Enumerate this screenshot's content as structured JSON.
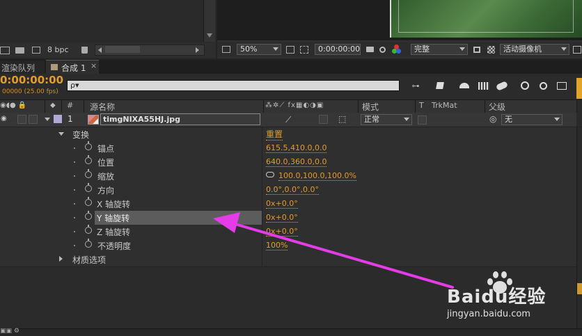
{
  "project_panel": {
    "bpc_label": "8 bpc"
  },
  "viewer": {
    "zoom": "50%",
    "timecode": "0:00:00:00",
    "resolution": "完整",
    "camera": "活动摄像机"
  },
  "tabs": [
    {
      "label": "渲染队列"
    },
    {
      "label": "合成 1"
    }
  ],
  "timeline": {
    "current_time": "0:00:00:00",
    "frame_info": "00000 (25.00 fps)",
    "search_placeholder": "",
    "search_glyph": "ρ▾",
    "columns": {
      "num": "#",
      "source_name": "源名称",
      "mode": "模式",
      "t": "T",
      "trkmat": "TrkMat",
      "parent": "父级"
    },
    "layer": {
      "index": "1",
      "name": "timgNIXA55HJ.jpg",
      "mode": "正常",
      "parent": "无"
    },
    "transform": {
      "label": "变换",
      "reset": "重置",
      "properties": [
        {
          "name": "锚点",
          "value": "615.5,410.0,0.0"
        },
        {
          "name": "位置",
          "value": "640.0,360.0,0.0"
        },
        {
          "name": "缩放",
          "value": "100.0,100.0,100.0%"
        },
        {
          "name": "方向",
          "value": "0.0°,0.0°,0.0°"
        },
        {
          "name": "X 轴旋转",
          "value": "0x+0.0°"
        },
        {
          "name": "Y 轴旋转",
          "value": "0x+0.0°"
        },
        {
          "name": "Z 轴旋转",
          "value": "0x+0.0°"
        },
        {
          "name": "不透明度",
          "value": "100%"
        }
      ]
    },
    "material_options": "材质选项"
  },
  "colors": {
    "accent": "#e49b2c",
    "annotation_arrow": "#e43ce6",
    "panel_bg": "#2c2c2c",
    "selected_row": "#5c5c5c"
  },
  "watermark": {
    "brand": "Baidu经验",
    "url": "jingyan.baidu.com"
  }
}
